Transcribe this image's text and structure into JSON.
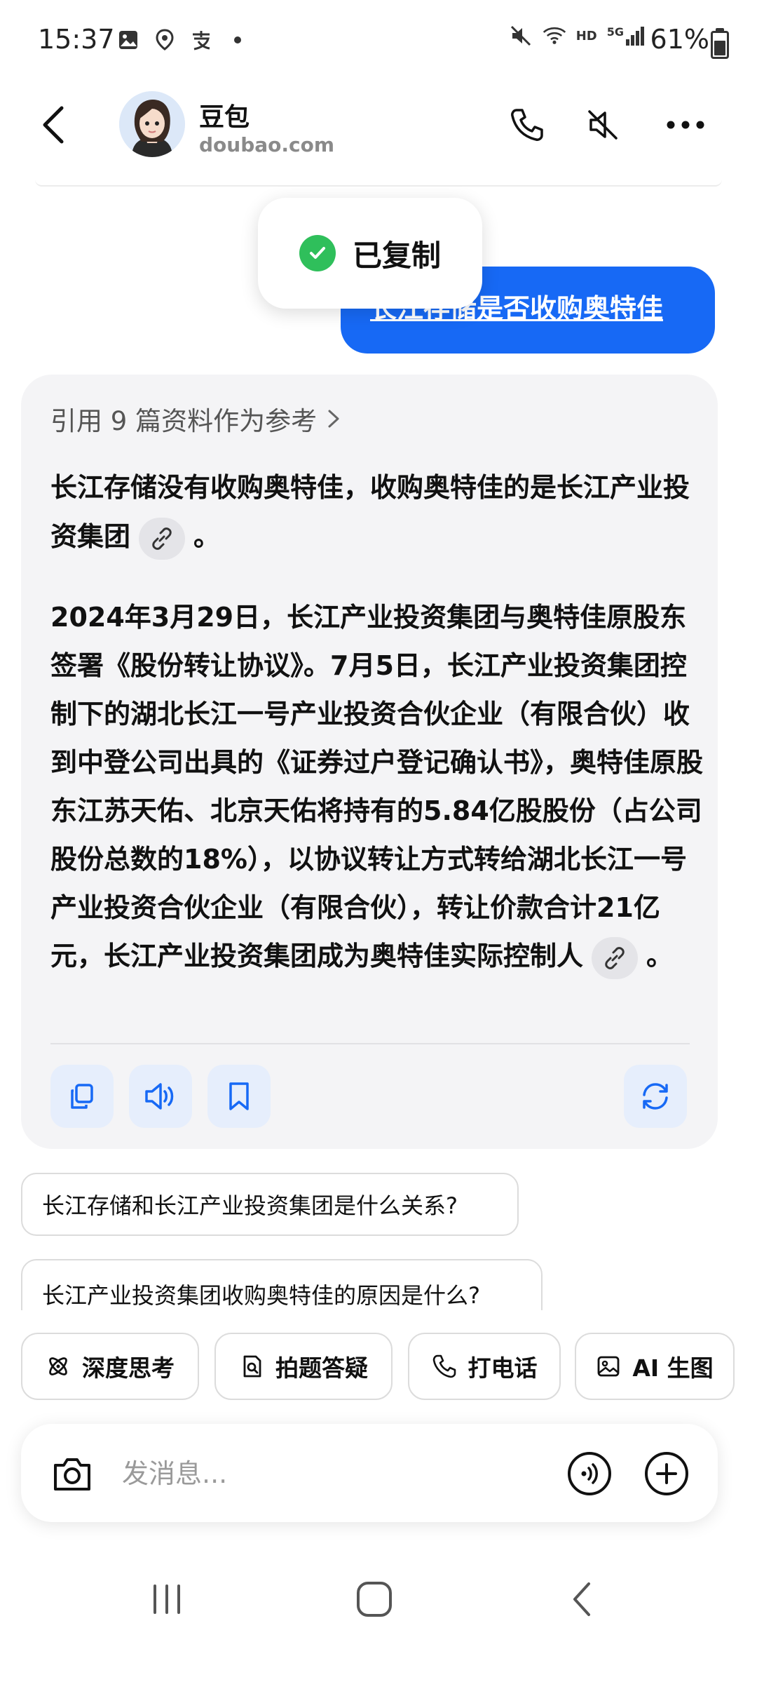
{
  "status_bar": {
    "time": "15:37",
    "network": "HD",
    "signal": "5G",
    "battery_percent": "61%",
    "battery_level": 0.61
  },
  "header": {
    "title": "豆包",
    "subtitle": "doubao.com"
  },
  "toast": {
    "text": "已复制"
  },
  "user_message": {
    "text": "长江存储是否收购奥特佳"
  },
  "answer": {
    "reference_label": "引用 9 篇资料作为参考",
    "paragraph1": "长江存储没有收购奥特佳，收购奥特佳的是长江产业投资集团",
    "paragraph1_end": "。",
    "paragraph2": "2024年3月29日，长江产业投资集团与奥特佳原股东签署《股份转让协议》。7月5日，长江产业投资集团控制下的湖北长江一号产业投资合伙企业（有限合伙）收到中登公司出具的《证券过户登记确认书》，奥特佳原股东江苏天佑、北京天佑将持有的5.84亿股股份（占公司股份总数的18%），以协议转让方式转给湖北长江一号产业投资合伙企业（有限合伙），转让价款合计21亿元，长江产业投资集团成为奥特佳实际控制人",
    "paragraph2_end": "。"
  },
  "suggestions": [
    "长江存储和长江产业投资集团是什么关系?",
    "长江产业投资集团收购奥特佳的原因是什么?"
  ],
  "quick_actions": [
    {
      "label": "深度思考",
      "icon": "atom-icon"
    },
    {
      "label": "拍题答疑",
      "icon": "scan-doc-icon"
    },
    {
      "label": "打电话",
      "icon": "phone-icon"
    },
    {
      "label": "AI 生图",
      "icon": "image-icon"
    }
  ],
  "composer": {
    "placeholder": "发消息..."
  },
  "colors": {
    "accent": "#1769f5",
    "card_bg": "#f4f4f6",
    "action_bg": "#e6eefc",
    "success": "#2fbf5b"
  }
}
